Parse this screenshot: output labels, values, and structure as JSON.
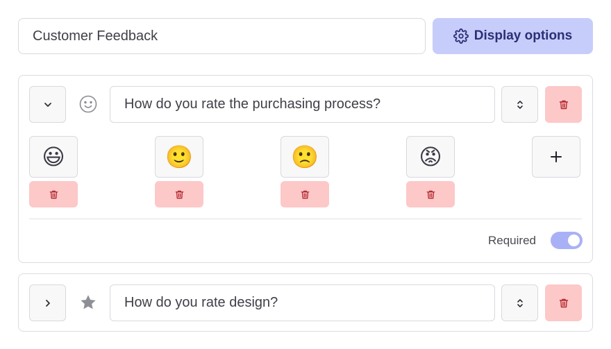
{
  "survey": {
    "title_value": "Customer Feedback",
    "display_options_label": "Display options"
  },
  "questions": [
    {
      "type_icon": "smiley-icon",
      "text": "How do you rate the purchasing process?",
      "expanded": true,
      "options": [
        {
          "emoji": "😃",
          "name": "grinning-face"
        },
        {
          "emoji": "🙂",
          "name": "slightly-smiling-face"
        },
        {
          "emoji": "🙁",
          "name": "slightly-frowning-face"
        },
        {
          "emoji": "😡",
          "name": "angry-face"
        }
      ],
      "required_label": "Required",
      "required": true
    },
    {
      "type_icon": "star-icon",
      "text": "How do you rate design?",
      "expanded": false
    }
  ],
  "colors": {
    "primary_light": "#c7cdfb",
    "primary_text": "#2c2f74",
    "danger_light": "#fdc8c8",
    "danger_icon": "#b3262d",
    "toggle_on": "#a9b1f6"
  }
}
